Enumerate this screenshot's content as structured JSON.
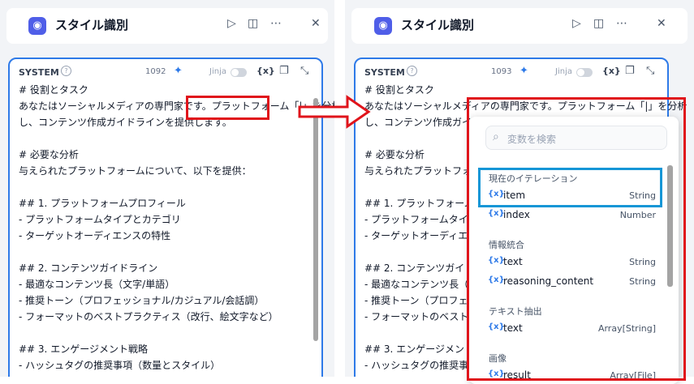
{
  "left": {
    "title": "スタイル識別",
    "label": "SYSTEM",
    "count": "1092",
    "jinja": "Jinja",
    "var": "{x}",
    "lines": [
      "# 役割とタスク",
      "あなたはソーシャルメディアの専門家です。プラットフォーム「|」を分析",
      "し、コンテンツ作成ガイドラインを提供します。",
      "",
      "# 必要な分析",
      "与えられたプラットフォームについて、以下を提供：",
      "",
      "## 1. プラットフォームプロフィール",
      "- プラットフォームタイプとカテゴリ",
      "- ターゲットオーディエンスの特性",
      "",
      "## 2. コンテンツガイドライン",
      "- 最適なコンテンツ長（文字/単語）",
      "- 推奨トーン（プロフェッショナル/カジュアル/会話調）",
      "- フォーマットのベストプラクティス（改行、絵文字など）",
      "",
      "## 3. エンゲージメント戦略",
      "- ハッシュタグの推奨事項（数量とスタイル）"
    ]
  },
  "right": {
    "title": "スタイル識別",
    "label": "SYSTEM",
    "count": "1093",
    "jinja": "Jinja",
    "var": "{x}",
    "lines": [
      "# 役割とタスク",
      "あなたはソーシャルメディアの専門家です。プラットフォーム「|」を分析",
      "し、コンテンツ作成ガイドラ",
      "",
      "# 必要な分析",
      "与えられたプラットフォーム",
      "",
      "## 1. プラットフォームプ",
      "- プラットフォームタイプと",
      "- ターゲットオーディエンス",
      "",
      "## 2. コンテンツガイドラ",
      "- 最適なコンテンツ長（文",
      "- 推奨トーン（プロフェッシ",
      "- フォーマットのベストプ",
      "",
      "## 3. エンゲージメント戦略",
      "- ハッシュタグの推奨事項"
    ]
  },
  "dropdown": {
    "search_placeholder": "変数を検索",
    "groups": [
      {
        "label": "現在のイテレーション",
        "items": [
          {
            "name": "item",
            "type": "String"
          },
          {
            "name": "index",
            "type": "Number"
          }
        ]
      },
      {
        "label": "情報統合",
        "items": [
          {
            "name": "text",
            "type": "String"
          },
          {
            "name": "reasoning_content",
            "type": "String"
          }
        ]
      },
      {
        "label": "テキスト抽出",
        "items": [
          {
            "name": "text",
            "type": "Array[String]"
          }
        ]
      },
      {
        "label": "画像",
        "items": [
          {
            "name": "result",
            "type": "Array[File]"
          }
        ]
      }
    ]
  },
  "colors": {
    "accent": "#2e7ae8",
    "annotation_red": "#e0141b",
    "annotation_blue": "#1596d6"
  }
}
